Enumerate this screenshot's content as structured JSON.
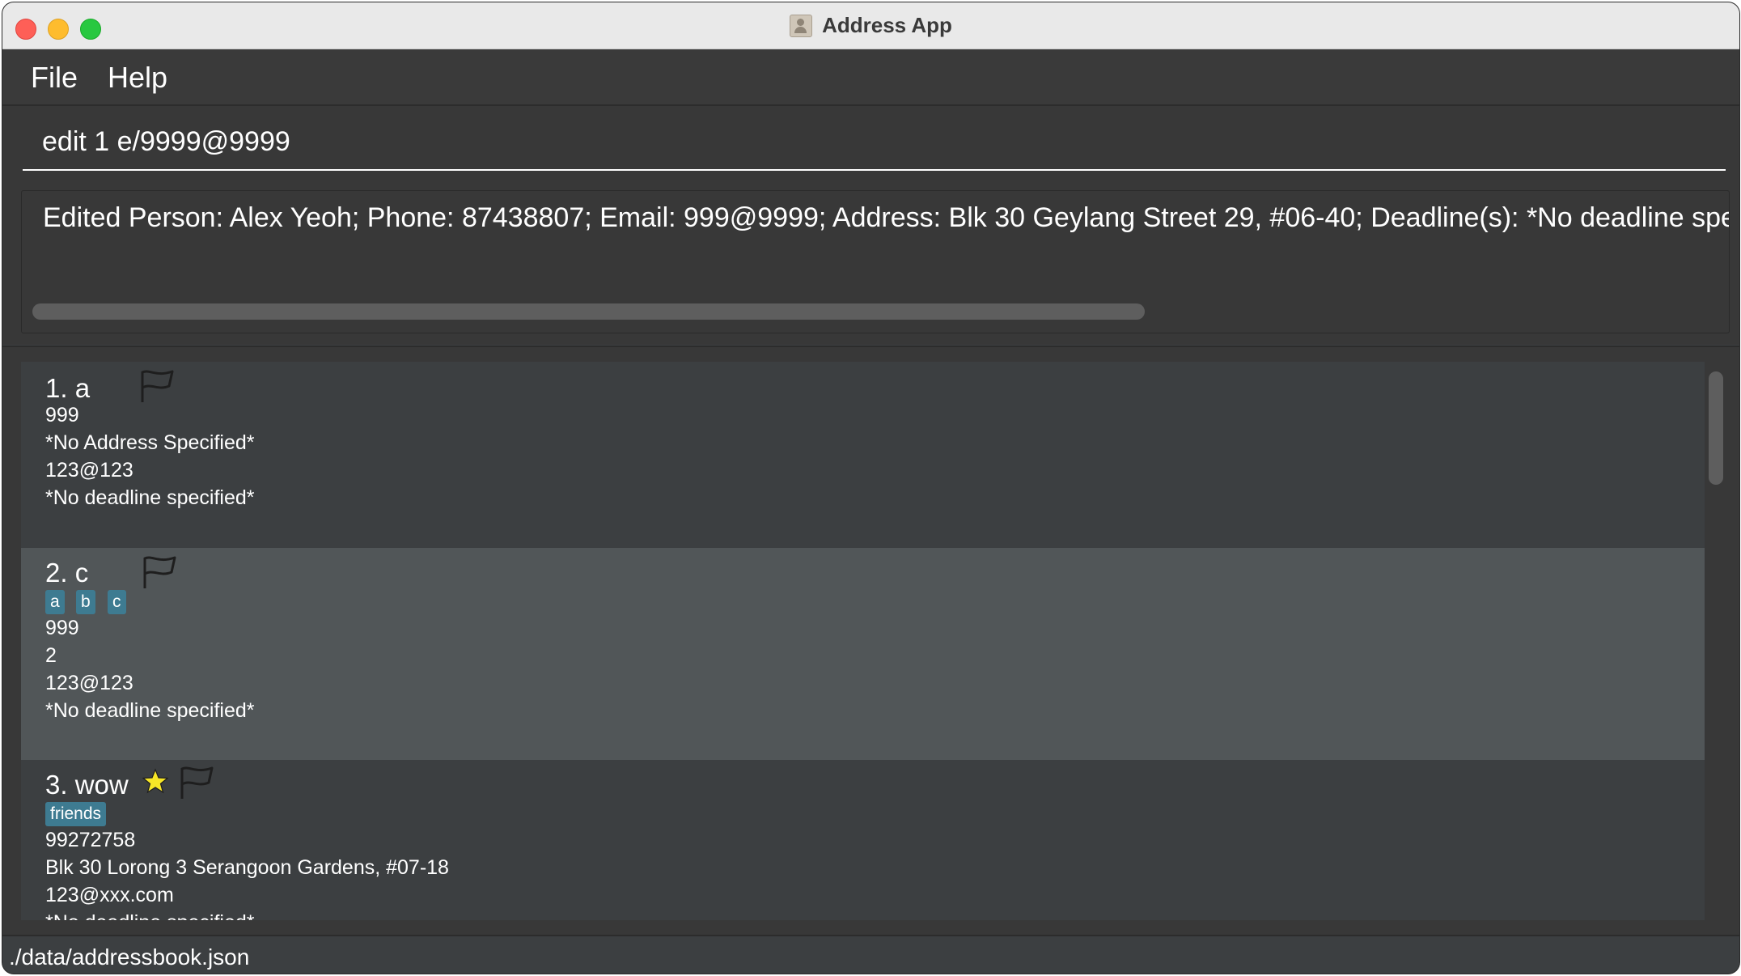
{
  "window": {
    "title": "Address App"
  },
  "menu": {
    "file": "File",
    "help": "Help"
  },
  "command": {
    "value": "edit 1 e/9999@9999"
  },
  "result": {
    "text": "Edited Person: Alex Yeoh; Phone: 87438807; Email: 999@9999; Address: Blk 30 Geylang Street 29, #06-40; Deadline(s): *No deadline specified*"
  },
  "persons": [
    {
      "title": "1.  a",
      "starred": false,
      "tags": [],
      "phone": "999",
      "address": "*No Address Specified*",
      "email": "123@123",
      "deadline": "*No deadline specified*"
    },
    {
      "title": "2.  c",
      "starred": false,
      "selected": true,
      "tags": [
        "a",
        "b",
        "c"
      ],
      "phone": "999",
      "address": "2",
      "email": "123@123",
      "deadline": "*No deadline specified*"
    },
    {
      "title": "3.  wow",
      "starred": true,
      "tags": [
        "friends"
      ],
      "phone": "99272758",
      "address": "Blk 30 Lorong 3 Serangoon Gardens, #07-18",
      "email": "123@xxx.com",
      "deadline": "*No deadline specified*"
    }
  ],
  "status": {
    "file_path": "./data/addressbook.json"
  },
  "icons": {
    "flag": "flag-icon",
    "star": "star-icon",
    "app": "address-app-icon"
  },
  "colors": {
    "tag": "#3e7b91",
    "star": "#f7e627",
    "selected_card": "#515658",
    "card": "#3c3f41"
  }
}
